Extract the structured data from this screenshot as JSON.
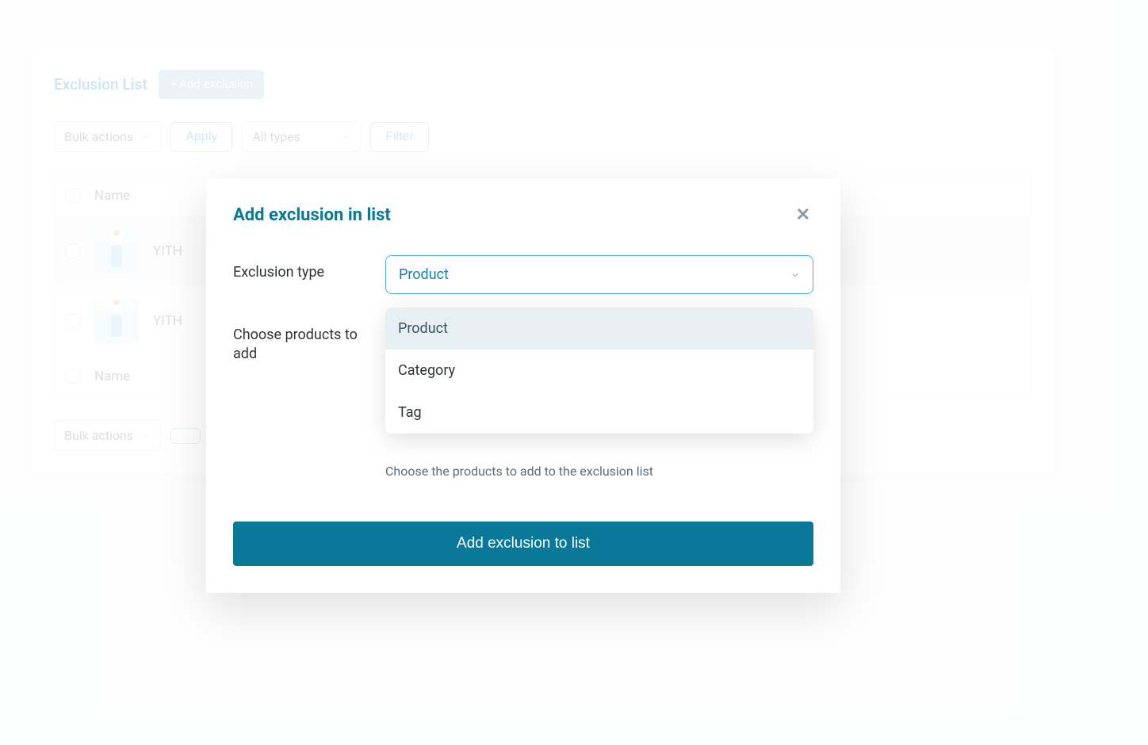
{
  "page": {
    "title": "Exclusion List",
    "add_button": "+ Add exclusion"
  },
  "toolbar": {
    "bulk_actions": "Bulk actions",
    "apply": "Apply",
    "all_types": "All types",
    "filter": "Filter"
  },
  "table": {
    "col_name": "Name",
    "rows": [
      {
        "label": "YITH"
      },
      {
        "label": "YITH"
      }
    ]
  },
  "modal": {
    "title": "Add exclusion in list",
    "close": "✕",
    "exclusion_type_label": "Exclusion type",
    "exclusion_type_selected": "Product",
    "options": [
      "Product",
      "Category",
      "Tag"
    ],
    "choose_products_label": "Choose products to add",
    "choose_products_help": "Choose the products to add to the exclusion list",
    "submit": "Add exclusion to list"
  },
  "colors": {
    "accent": "#0a7899",
    "accent_light": "#49b1d9"
  }
}
